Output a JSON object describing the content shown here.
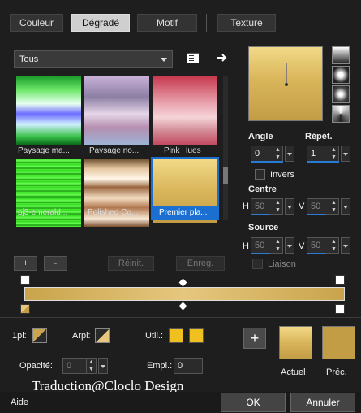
{
  "tabs": [
    {
      "label": "Couleur",
      "active": false
    },
    {
      "label": "Dégradé",
      "active": true
    },
    {
      "label": "Motif",
      "active": false
    },
    {
      "label": "Texture",
      "active": false
    }
  ],
  "category_dropdown": {
    "value": "Tous"
  },
  "gradients": [
    {
      "label": "Paysage ma...",
      "selected": false
    },
    {
      "label": "Paysage no...",
      "selected": false
    },
    {
      "label": "Pink Hues",
      "selected": false
    },
    {
      "label": "pj3-emerald...",
      "selected": false
    },
    {
      "label": "Polished Co...",
      "selected": false
    },
    {
      "label": "Premier pla...",
      "selected": true
    }
  ],
  "list_buttons": {
    "add": "+",
    "remove": "-",
    "reset": "Réinit.",
    "save": "Enreg."
  },
  "angle": {
    "label": "Angle",
    "value": "0"
  },
  "repeat": {
    "label": "Répét.",
    "value": "1"
  },
  "invert": {
    "label": "Invers",
    "checked": false
  },
  "center": {
    "label": "Centre",
    "h_label": "H",
    "h_value": "50",
    "v_label": "V",
    "v_value": "50"
  },
  "source": {
    "label": "Source",
    "h_label": "H",
    "h_value": "50",
    "v_label": "V",
    "v_value": "50"
  },
  "link": {
    "label": "Liaison",
    "checked": false
  },
  "bottom": {
    "one_pl_label": "1pl:",
    "arpl_label": "Arpl:",
    "util_label": "Util.:",
    "opacity_label": "Opacité:",
    "opacity_value": "0",
    "empl_label": "Empl.:",
    "empl_value": "0",
    "add_button": "+",
    "current_label": "Actuel",
    "previous_label": "Préc."
  },
  "colors": {
    "gold_light": "#e6c77d",
    "gold_dark": "#c39d46",
    "util_yellow": "#f0c020",
    "accent_blue": "#1a6fd1"
  },
  "credit": "Traduction@Cloclo Design",
  "footer": {
    "help": "Aide",
    "ok": "OK",
    "cancel": "Annuler"
  }
}
